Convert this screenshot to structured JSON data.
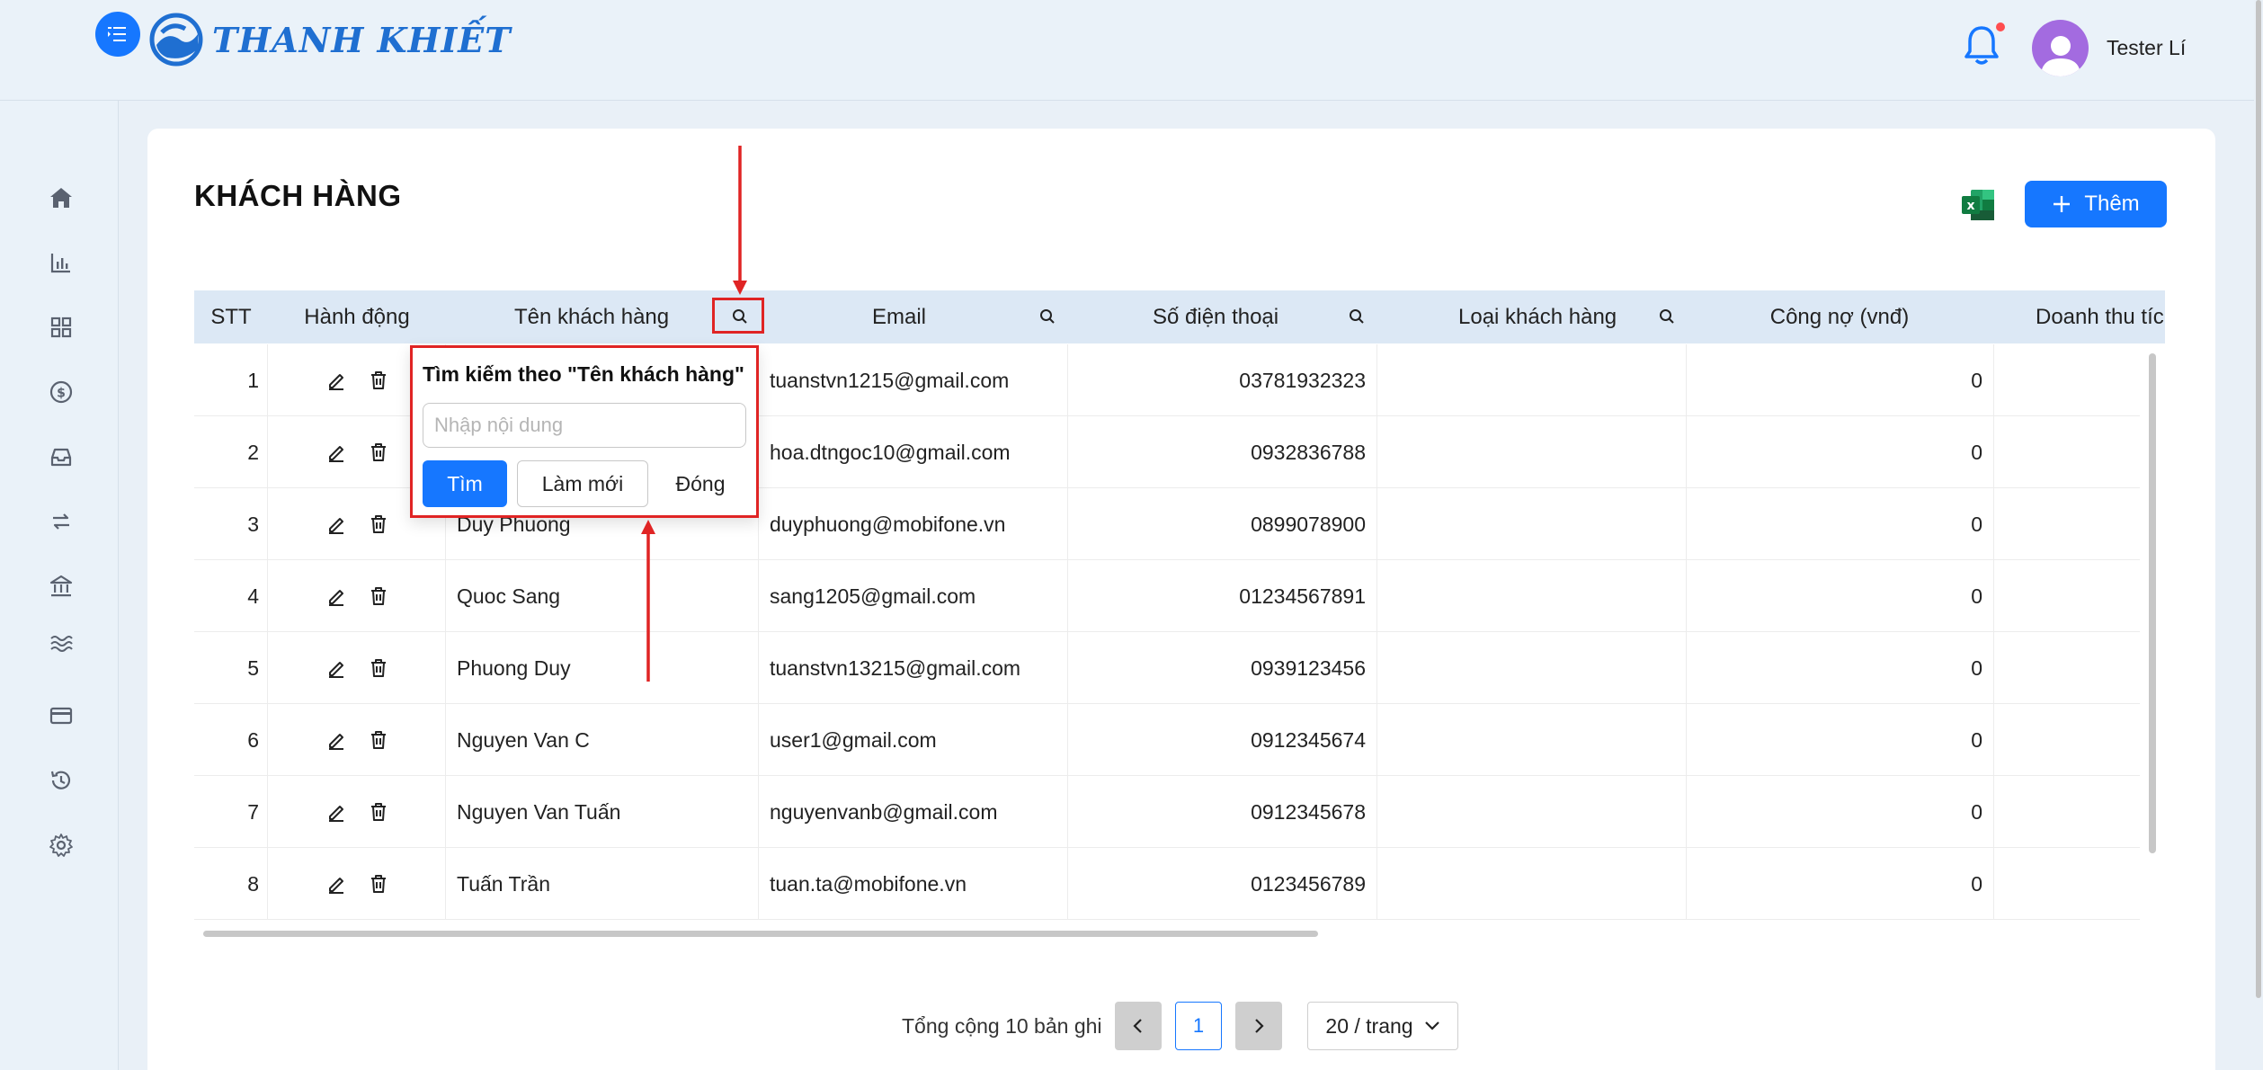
{
  "header": {
    "brand": "THANH KHIẾT",
    "user_name": "Tester Lí"
  },
  "sidebar": {
    "items": [
      "home-icon",
      "chart-icon",
      "grid-icon",
      "dollar-icon",
      "inbox-icon",
      "transfer-icon",
      "bank-icon",
      "water-icon",
      "card-icon",
      "history-icon",
      "settings-icon"
    ]
  },
  "page": {
    "title": "KHÁCH HÀNG",
    "add_label": "Thêm"
  },
  "table": {
    "columns": [
      "STT",
      "Hành động",
      "Tên khách hàng",
      "Email",
      "Số điện thoại",
      "Loại khách hàng",
      "Công nợ (vnđ)",
      "Doanh thu tích"
    ],
    "rows": [
      {
        "stt": "1",
        "name": "",
        "email": "tuanstvn1215@gmail.com",
        "phone": "03781932323",
        "type": "",
        "debt": "0"
      },
      {
        "stt": "2",
        "name": "",
        "email": "hoa.dtngoc10@gmail.com",
        "phone": "0932836788",
        "type": "",
        "debt": "0"
      },
      {
        "stt": "3",
        "name": "Duy Phuong",
        "email": "duyphuong@mobifone.vn",
        "phone": "0899078900",
        "type": "",
        "debt": "0"
      },
      {
        "stt": "4",
        "name": "Quoc Sang",
        "email": "sang1205@gmail.com",
        "phone": "01234567891",
        "type": "",
        "debt": "0"
      },
      {
        "stt": "5",
        "name": "Phuong Duy",
        "email": "tuanstvn13215@gmail.com",
        "phone": "0939123456",
        "type": "",
        "debt": "0"
      },
      {
        "stt": "6",
        "name": "Nguyen Van C",
        "email": "user1@gmail.com",
        "phone": "0912345674",
        "type": "",
        "debt": "0"
      },
      {
        "stt": "7",
        "name": "Nguyen Van Tuấn",
        "email": "nguyenvanb@gmail.com",
        "phone": "0912345678",
        "type": "",
        "debt": "0"
      },
      {
        "stt": "8",
        "name": "Tuấn Trần",
        "email": "tuan.ta@mobifone.vn",
        "phone": "0123456789",
        "type": "",
        "debt": "0"
      }
    ]
  },
  "search_popup": {
    "title": "Tìm kiếm theo \"Tên khách hàng\"",
    "input_value": "",
    "placeholder": "Nhập nội dung",
    "search_label": "Tìm",
    "reset_label": "Làm mới",
    "close_label": "Đóng"
  },
  "pagination": {
    "total_text": "Tổng cộng 10 bản ghi",
    "current_page": "1",
    "page_size": "20 / trang"
  },
  "colors": {
    "primary": "#1677ff",
    "annotation": "#e02424",
    "table_header": "#dce8f5"
  }
}
